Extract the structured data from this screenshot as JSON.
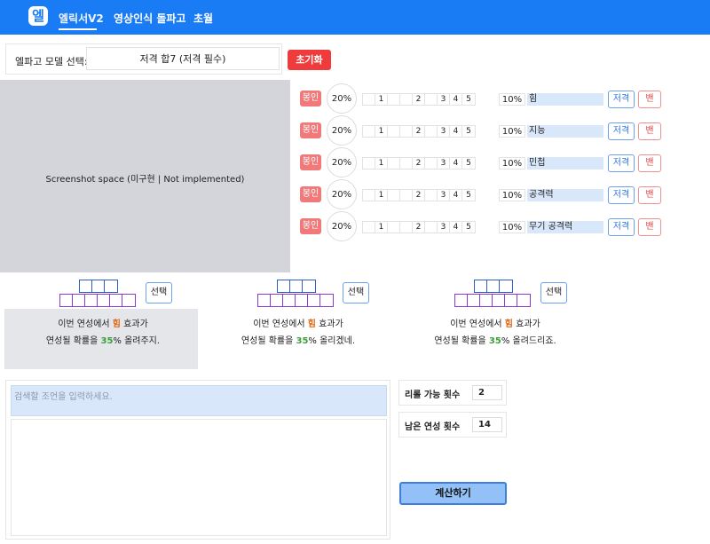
{
  "header": {
    "logo": "엘",
    "nav": [
      "엘릭서V2",
      "영상인식 돌파고",
      "초월"
    ],
    "brand_color": "#1a7cf5"
  },
  "model": {
    "label": "엘파고 모델 선택:",
    "selected": "저격 합7 (저격 필수)",
    "reset_label": "초기화"
  },
  "screenshot": {
    "placeholder": "Screenshot space (미구현 | Not implemented)"
  },
  "options": [
    {
      "seal": "봉인",
      "chance": "20%",
      "cells": [
        "",
        "1",
        "",
        "",
        "2",
        "",
        "3",
        "4",
        "5"
      ],
      "pct": "10%",
      "name": "힘",
      "sniper": "저격",
      "ban": "밴"
    },
    {
      "seal": "봉인",
      "chance": "20%",
      "cells": [
        "",
        "1",
        "",
        "",
        "2",
        "",
        "3",
        "4",
        "5"
      ],
      "pct": "10%",
      "name": "지능",
      "sniper": "저격",
      "ban": "밴"
    },
    {
      "seal": "봉인",
      "chance": "20%",
      "cells": [
        "",
        "1",
        "",
        "",
        "2",
        "",
        "3",
        "4",
        "5"
      ],
      "pct": "10%",
      "name": "민첩",
      "sniper": "저격",
      "ban": "밴"
    },
    {
      "seal": "봉인",
      "chance": "20%",
      "cells": [
        "",
        "1",
        "",
        "",
        "2",
        "",
        "3",
        "4",
        "5"
      ],
      "pct": "10%",
      "name": "공격력",
      "sniper": "저격",
      "ban": "밴"
    },
    {
      "seal": "봉인",
      "chance": "20%",
      "cells": [
        "",
        "1",
        "",
        "",
        "2",
        "",
        "3",
        "4",
        "5"
      ],
      "pct": "10%",
      "name": "무기 공격력",
      "sniper": "저격",
      "ban": "밴"
    }
  ],
  "choices": [
    {
      "select_label": "선택",
      "line1_pre": "이번 연성에서 ",
      "keyword": "힘",
      "line1_post": " 효과가",
      "line2_pre": "연성될 확률을 ",
      "number": "35",
      "line2_post": "% 올려주지."
    },
    {
      "select_label": "선택",
      "line1_pre": "이번 연성에서 ",
      "keyword": "힘",
      "line1_post": " 효과가",
      "line2_pre": "연성될 확률을 ",
      "number": "35",
      "line2_post": "% 올리겠네."
    },
    {
      "select_label": "선택",
      "line1_pre": "이번 연성에서 ",
      "keyword": "힘",
      "line1_post": " 효과가",
      "line2_pre": "연성될 확률을 ",
      "number": "35",
      "line2_post": "% 올려드리죠."
    }
  ],
  "search": {
    "placeholder": "검색할 조언을 입력하세요."
  },
  "stats": {
    "reroll_label": "리롤 가능 횟수",
    "reroll_value": "2",
    "remaining_label": "남은 연성 횟수",
    "remaining_value": "14"
  },
  "calc_label": "계산하기"
}
